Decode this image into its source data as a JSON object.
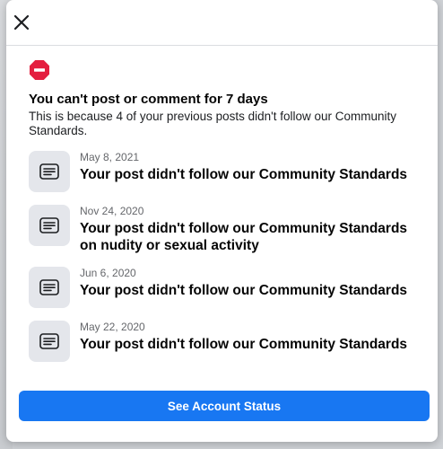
{
  "colors": {
    "primary": "#1877f2",
    "warning_red": "#e41e3f",
    "tile_bg": "#e4e6eb",
    "text_primary": "#050505",
    "text_secondary": "#65676b"
  },
  "header": {
    "close_icon": "close-icon"
  },
  "notice": {
    "icon": "no-entry-icon",
    "headline": "You can't post or comment for 7 days",
    "description": "This is because 4 of your previous posts didn't follow our Community Standards."
  },
  "violations": [
    {
      "icon": "document-icon",
      "date": "May 8, 2021",
      "title": "Your post didn't follow our Community Standards"
    },
    {
      "icon": "document-icon",
      "date": "Nov 24, 2020",
      "title": "Your post didn't follow our Community Standards on nudity or sexual activity"
    },
    {
      "icon": "document-icon",
      "date": "Jun 6, 2020",
      "title": "Your post didn't follow our Community Standards"
    },
    {
      "icon": "document-icon",
      "date": "May 22, 2020",
      "title": "Your post didn't follow our Community Standards"
    }
  ],
  "footer": {
    "cta_label": "See Account Status"
  }
}
